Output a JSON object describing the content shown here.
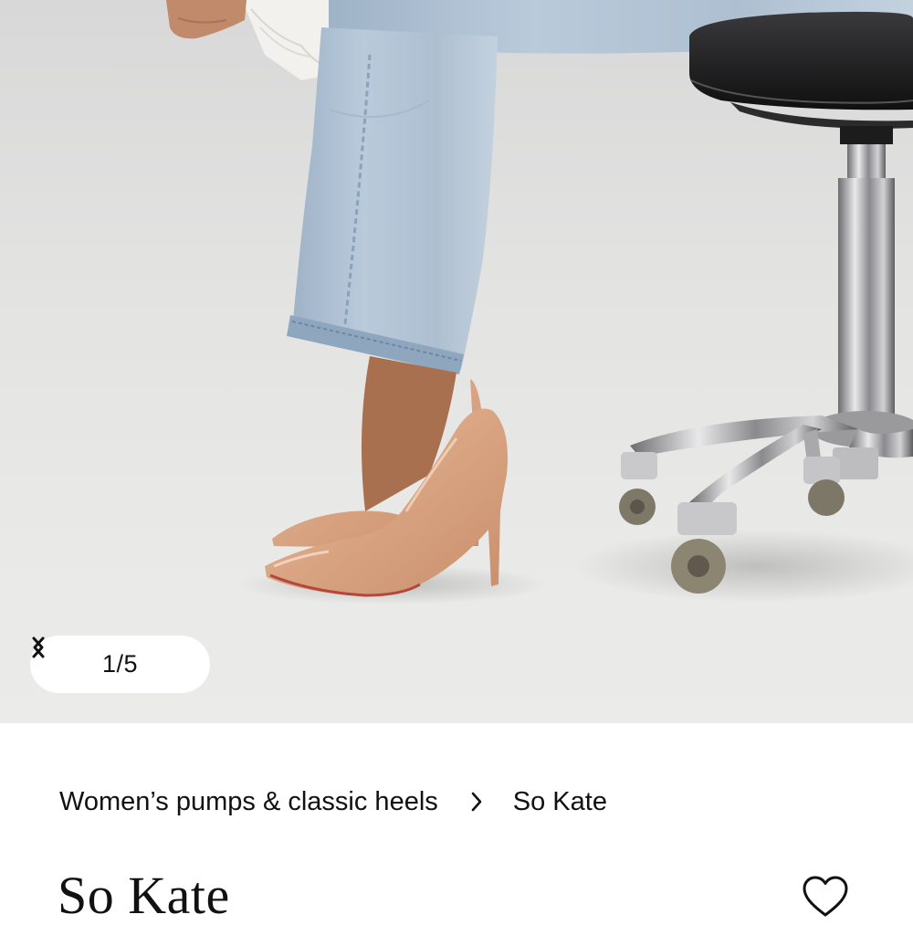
{
  "gallery": {
    "image_alt": "Model wearing nude So Kate pumps, seated on a stool",
    "current": 1,
    "total": 5,
    "counter": "1/5",
    "prev_icon": "chevron-left-icon",
    "next_icon": "chevron-right-icon"
  },
  "breadcrumb": {
    "category": "Women’s pumps & classic heels",
    "separator_icon": "chevron-right-icon",
    "current": "So Kate"
  },
  "product": {
    "title": "So Kate",
    "wishlist_icon": "heart-outline-icon"
  },
  "colors": {
    "background": "#ffffff",
    "text": "#111111",
    "photo_backdrop": "#e6e6e4"
  }
}
